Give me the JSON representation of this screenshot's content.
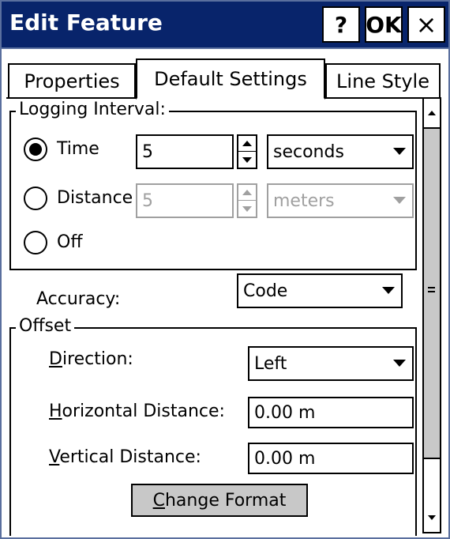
{
  "window": {
    "title": "Edit Feature",
    "help_label": "?",
    "ok_label": "OK",
    "close_label": "×"
  },
  "tabs": [
    {
      "label": "Properties",
      "active": false
    },
    {
      "label": "Default Settings",
      "active": true
    },
    {
      "label": "Line Style",
      "active": false
    }
  ],
  "logging": {
    "legend": "Logging Interval:",
    "options": [
      {
        "label": "Time",
        "selected": true,
        "value": "5",
        "unit": "seconds",
        "enabled": true
      },
      {
        "label": "Distance",
        "selected": false,
        "value": "5",
        "unit": "meters",
        "enabled": false
      },
      {
        "label": "Off",
        "selected": false
      }
    ]
  },
  "accuracy": {
    "label": "Accuracy:",
    "value": "Code"
  },
  "offset": {
    "legend": "Offset",
    "direction_label_key": "D",
    "direction_label_rest": "irection:",
    "direction_value": "Left",
    "horizontal_label_key": "H",
    "horizontal_label_rest": "orizontal Distance:",
    "horizontal_value": "0.00 m",
    "vertical_label_key": "V",
    "vertical_label_rest": "ertical Distance:",
    "vertical_value": "0.00 m",
    "change_format_key": "C",
    "change_format_rest": "hange Format"
  },
  "colors": {
    "titlebar": "#08246b",
    "button_face": "#c8c8c8",
    "disabled_text": "#a0a0a0"
  }
}
